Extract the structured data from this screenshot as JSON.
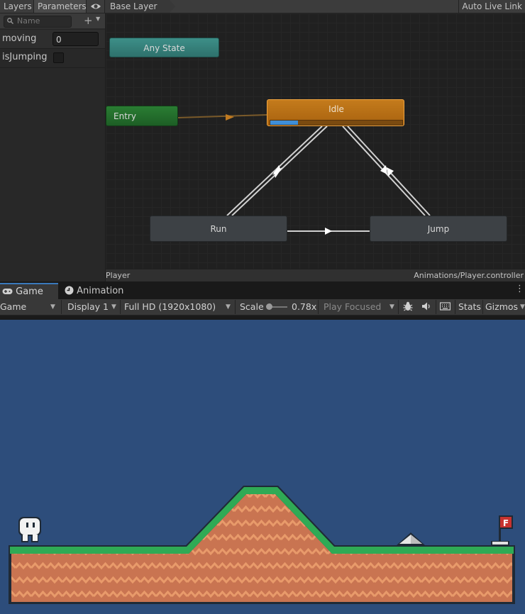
{
  "animator": {
    "tabs": {
      "layers": "Layers",
      "parameters": "Parameters"
    },
    "eye_icon": "eye-icon",
    "breadcrumb": "Base Layer",
    "auto_live_link": "Auto Live Link",
    "search_placeholder": "Name",
    "parameters": [
      {
        "name": "moving",
        "type": "int",
        "value": "0"
      },
      {
        "name": "isJumping",
        "type": "bool",
        "checked": false
      }
    ],
    "states": {
      "any_state": "Any State",
      "entry": "Entry",
      "idle": "Idle",
      "run": "Run",
      "jump": "Jump"
    },
    "idle_progress": 0.21,
    "status_left": "Player",
    "status_right": "Animations/Player.controller",
    "colors": {
      "idle": "#c47b1c",
      "entry": "#2a7d33",
      "any_state": "#3d8f88",
      "progress": "#3e8ed8"
    }
  },
  "game_panel": {
    "tabs": {
      "game": "Game",
      "animation": "Animation"
    },
    "toolbar": {
      "view": "Game",
      "display": "Display 1",
      "resolution": "Full HD (1920x1080)",
      "scale_label": "Scale",
      "scale_value": "0.78x",
      "play_mode": "Play Focused",
      "stats": "Stats",
      "gizmos": "Gizmos"
    },
    "icons": [
      "gamepad-icon",
      "animation-clock-icon",
      "bug-icon",
      "audio-icon",
      "keyboard-icon",
      "more-icon"
    ],
    "scene": {
      "background": "#2d4d7b",
      "flag_letter": "F"
    }
  }
}
